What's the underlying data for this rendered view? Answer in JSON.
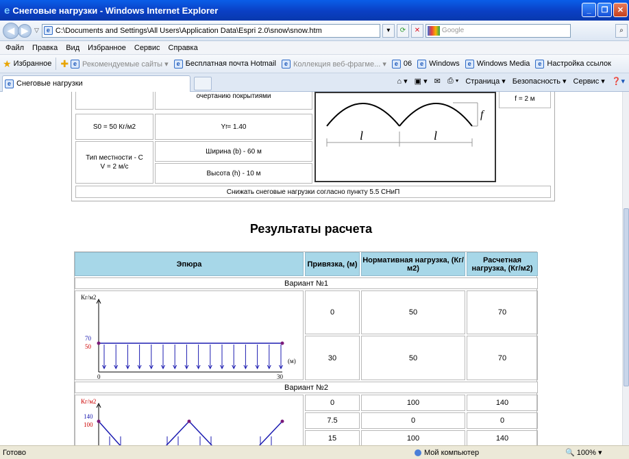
{
  "window": {
    "title": "Снеговые нагрузки - Windows Internet Explorer",
    "address": "C:\\Documents and Settings\\All Users\\Application Data\\Espri 2.0\\snow\\snow.htm",
    "search_placeholder": "Google"
  },
  "menu": [
    "Файл",
    "Правка",
    "Вид",
    "Избранное",
    "Сервис",
    "Справка"
  ],
  "favorites": {
    "label": "Избранное",
    "links": [
      {
        "label": "Рекомендуемые сайты ▾",
        "gray": true
      },
      {
        "label": "Бесплатная почта Hotmail",
        "gray": false
      },
      {
        "label": "Коллекция веб-фрагме... ▾",
        "gray": true
      },
      {
        "label": "06",
        "gray": false
      },
      {
        "label": "Windows",
        "gray": false
      },
      {
        "label": "Windows Media",
        "gray": false
      },
      {
        "label": "Настройка ссылок",
        "gray": false
      }
    ]
  },
  "tab": {
    "label": "Снеговые нагрузки"
  },
  "commands": [
    "Страница ▾",
    "Безопасность ▾",
    "Сервис ▾"
  ],
  "params": {
    "roof_note": "очертанию покрытиями",
    "s0": "S0 = 50 Кг/м2",
    "gamma_f_prefix": "Y",
    "gamma_f_sub": "f",
    "gamma_f_value": " = 1.40",
    "terrain": "Тип местности - C",
    "wind": "V = 2 м/с",
    "width": "Ширина (b) - 60 м",
    "height": "Высота (h) - 10 м",
    "f_value": "f = 2 м",
    "reduce_note": "Снижать снеговые нагрузки согласно пункту 5.5 СНиП",
    "scheme_f": "f",
    "scheme_l": "l"
  },
  "results": {
    "title": "Результаты расчета",
    "headers": {
      "epure": "Эпюра",
      "binding": "Привязка, (м)",
      "normative": "Нормативная нагрузка, (Кг/м2)",
      "design": "Расчетная нагрузка, (Кг/м2)"
    },
    "variant1": {
      "label": "Вариант №1",
      "rows": [
        {
          "binding": "0",
          "normative": "50",
          "design": "70"
        },
        {
          "binding": "30",
          "normative": "50",
          "design": "70"
        }
      ],
      "chart": {
        "ylabel": "Кг/м2",
        "xlabel": "(м)",
        "y_top": "70",
        "y_bot": "50",
        "x_start": "0",
        "x_end": "30"
      }
    },
    "variant2": {
      "label": "Вариант №2",
      "rows": [
        {
          "binding": "0",
          "normative": "100",
          "design": "140"
        },
        {
          "binding": "7.5",
          "normative": "0",
          "design": "0"
        },
        {
          "binding": "15",
          "normative": "100",
          "design": "140"
        }
      ],
      "chart": {
        "ylabel": "Кг/м2",
        "y_top": "140",
        "y_bot": "100"
      }
    }
  },
  "status": {
    "ready": "Готово",
    "zone": "Мой компьютер",
    "zoom": "100%"
  }
}
